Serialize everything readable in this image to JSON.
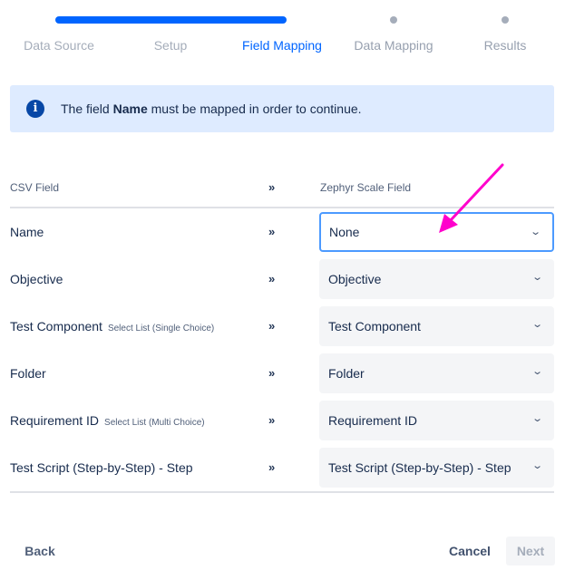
{
  "steps": [
    {
      "label": "Data Source"
    },
    {
      "label": "Setup"
    },
    {
      "label": "Field Mapping"
    },
    {
      "label": "Data Mapping"
    },
    {
      "label": "Results"
    }
  ],
  "progress": {
    "current_step": 3,
    "total_steps": 5
  },
  "banner": {
    "icon": "info-icon",
    "pre": "The field ",
    "bold": "Name",
    "post": " must be mapped in order to continue."
  },
  "table": {
    "col_csv": "CSV Field",
    "col_arrow": "»",
    "col_zephyr": "Zephyr Scale Field",
    "rows": [
      {
        "csv": "Name",
        "type": "",
        "value": "None"
      },
      {
        "csv": "Objective",
        "type": "",
        "value": "Objective"
      },
      {
        "csv": "Test Component",
        "type": "Select List (Single Choice)",
        "value": "Test Component"
      },
      {
        "csv": "Folder",
        "type": "",
        "value": "Folder"
      },
      {
        "csv": "Requirement ID",
        "type": "Select List (Multi Choice)",
        "value": "Requirement ID"
      },
      {
        "csv": "Test Script (Step-by-Step) - Step",
        "type": "",
        "value": "Test Script (Step-by-Step) - Step"
      }
    ]
  },
  "footer": {
    "back": "Back",
    "cancel": "Cancel",
    "next": "Next"
  },
  "colors": {
    "accent": "#0065ff",
    "annotation": "#ff00cc"
  }
}
